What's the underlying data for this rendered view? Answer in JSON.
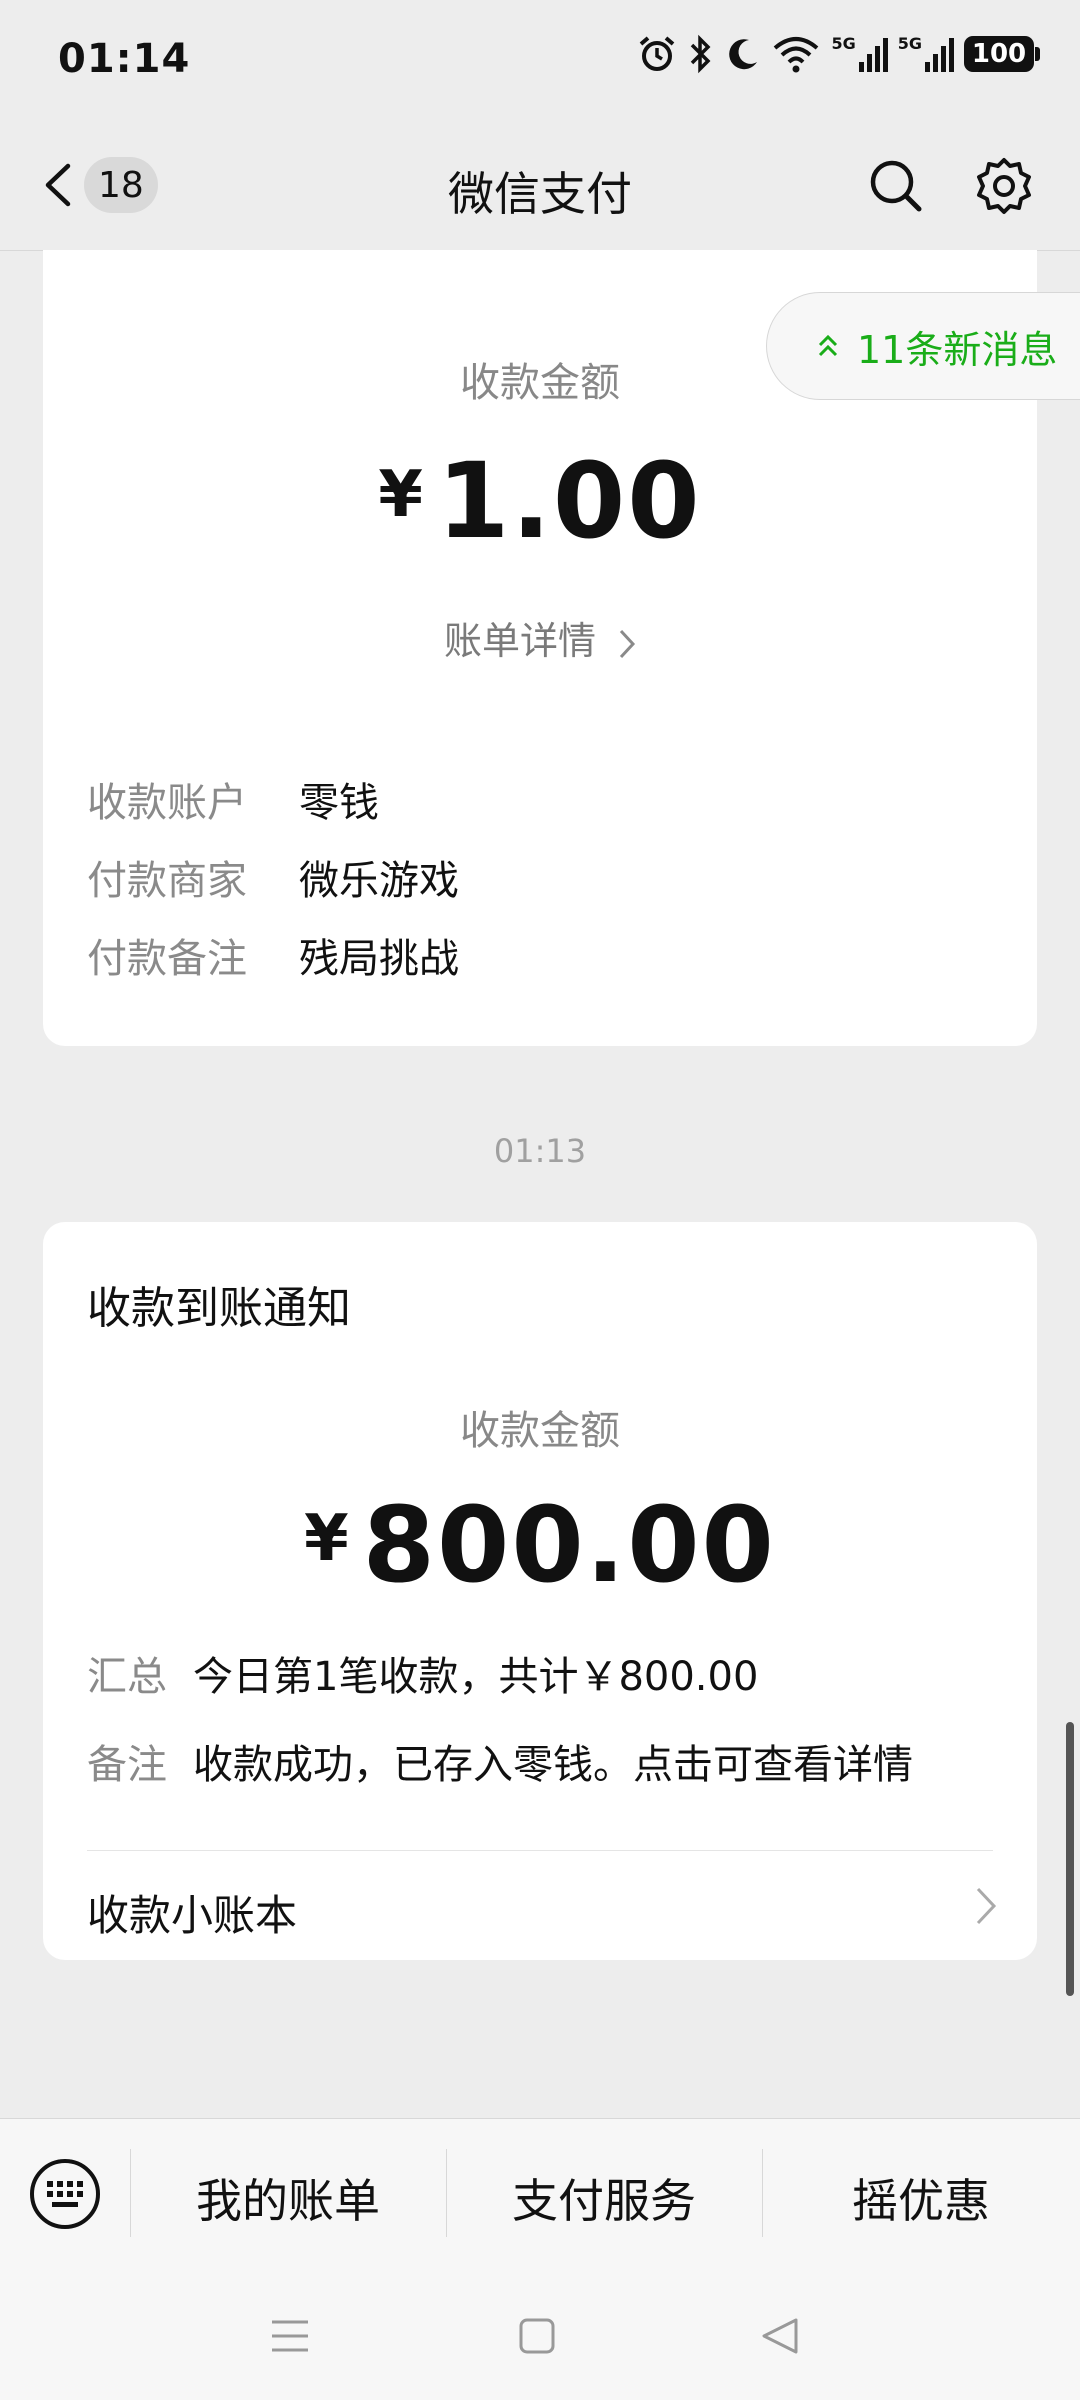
{
  "status_bar": {
    "time": "01:14",
    "signal1": "5G",
    "signal2": "5G",
    "battery": "100"
  },
  "nav": {
    "badge_count": "18",
    "title": "微信支付"
  },
  "new_messages": {
    "label": "11条新消息"
  },
  "card1": {
    "amount_label": "收款金额",
    "currency": "¥",
    "amount": "1.00",
    "detail_link": "账单详情",
    "rows": [
      {
        "key": "收款账户",
        "value": "零钱"
      },
      {
        "key": "付款商家",
        "value": "微乐游戏"
      },
      {
        "key": "付款备注",
        "value": "残局挑战"
      }
    ]
  },
  "timestamp": "01:13",
  "card2": {
    "title": "收款到账通知",
    "amount_label": "收款金额",
    "currency": "¥",
    "amount": "800.00",
    "summary_key": "汇总",
    "summary_value": "今日第1笔收款，共计￥800.00",
    "note_key": "备注",
    "note_value": "收款成功，已存入零钱。点击可查看详情",
    "ledger_label": "收款小账本"
  },
  "bottom_menu": {
    "items": [
      "我的账单",
      "支付服务",
      "摇优惠"
    ]
  },
  "colors": {
    "accent_green": "#1aad19",
    "background": "#ededed",
    "card": "#ffffff"
  }
}
